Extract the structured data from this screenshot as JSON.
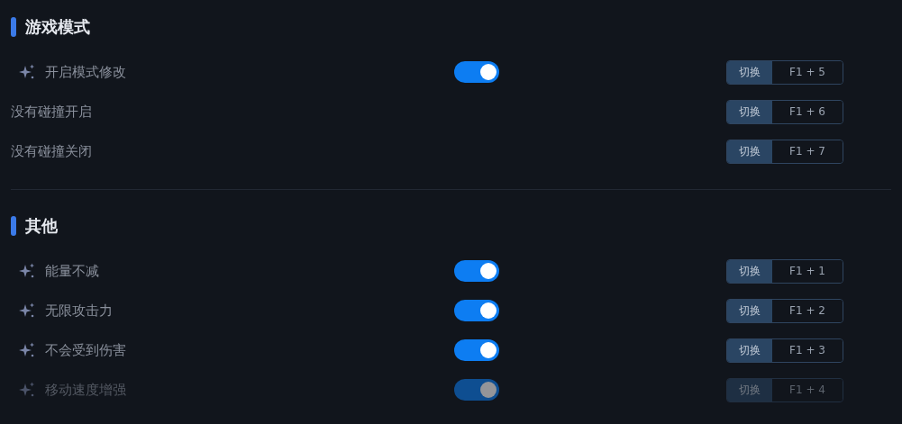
{
  "sections": [
    {
      "title": "游戏模式",
      "rows": [
        {
          "kind": "toggle",
          "label": "开启模式修改",
          "on": true,
          "disabled": false,
          "action": "切换",
          "hotkey": "F1 + 5"
        },
        {
          "kind": "plain",
          "label": "没有碰撞开启",
          "disabled": false,
          "action": "切换",
          "hotkey": "F1 + 6"
        },
        {
          "kind": "plain",
          "label": "没有碰撞关闭",
          "disabled": false,
          "action": "切换",
          "hotkey": "F1 + 7"
        }
      ]
    },
    {
      "title": "其他",
      "rows": [
        {
          "kind": "toggle",
          "label": "能量不减",
          "on": true,
          "disabled": false,
          "action": "切换",
          "hotkey": "F1 + 1"
        },
        {
          "kind": "toggle",
          "label": "无限攻击力",
          "on": true,
          "disabled": false,
          "action": "切换",
          "hotkey": "F1 + 2"
        },
        {
          "kind": "toggle",
          "label": "不会受到伤害",
          "on": true,
          "disabled": false,
          "action": "切换",
          "hotkey": "F1 + 3"
        },
        {
          "kind": "toggle",
          "label": "移动速度增强",
          "on": true,
          "disabled": true,
          "action": "切换",
          "hotkey": "F1 + 4"
        }
      ]
    }
  ]
}
